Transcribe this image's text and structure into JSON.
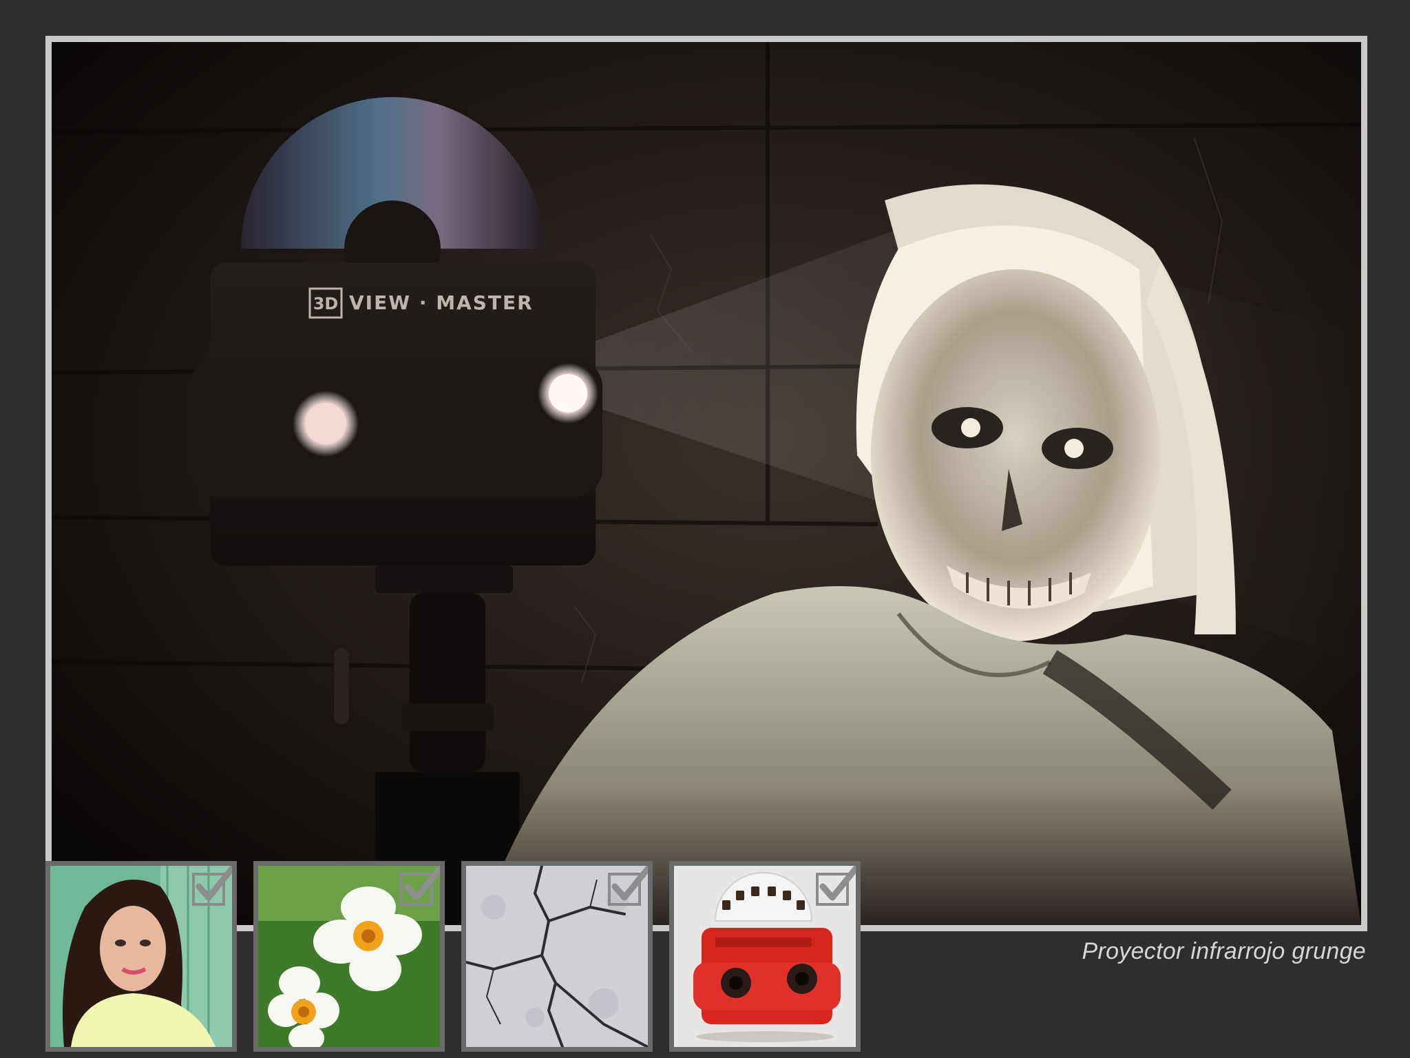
{
  "caption": "Proyector infrarrojo grunge",
  "main_image": {
    "icon": "view-master-projector-zombie-photo",
    "brand_text": "VIEW · MASTER",
    "brand_badge": "3D"
  },
  "thumbnails": [
    {
      "icon": "woman-portrait-photo",
      "checked": true
    },
    {
      "icon": "daffodils-photo",
      "checked": true
    },
    {
      "icon": "cracked-texture-photo",
      "checked": true
    },
    {
      "icon": "red-view-master-photo",
      "checked": true
    }
  ],
  "colors": {
    "background": "#2e2e30",
    "frame_border": "#c9c9c9",
    "thumb_border": "#6a6a6a",
    "caption": "#d6d6d6"
  }
}
